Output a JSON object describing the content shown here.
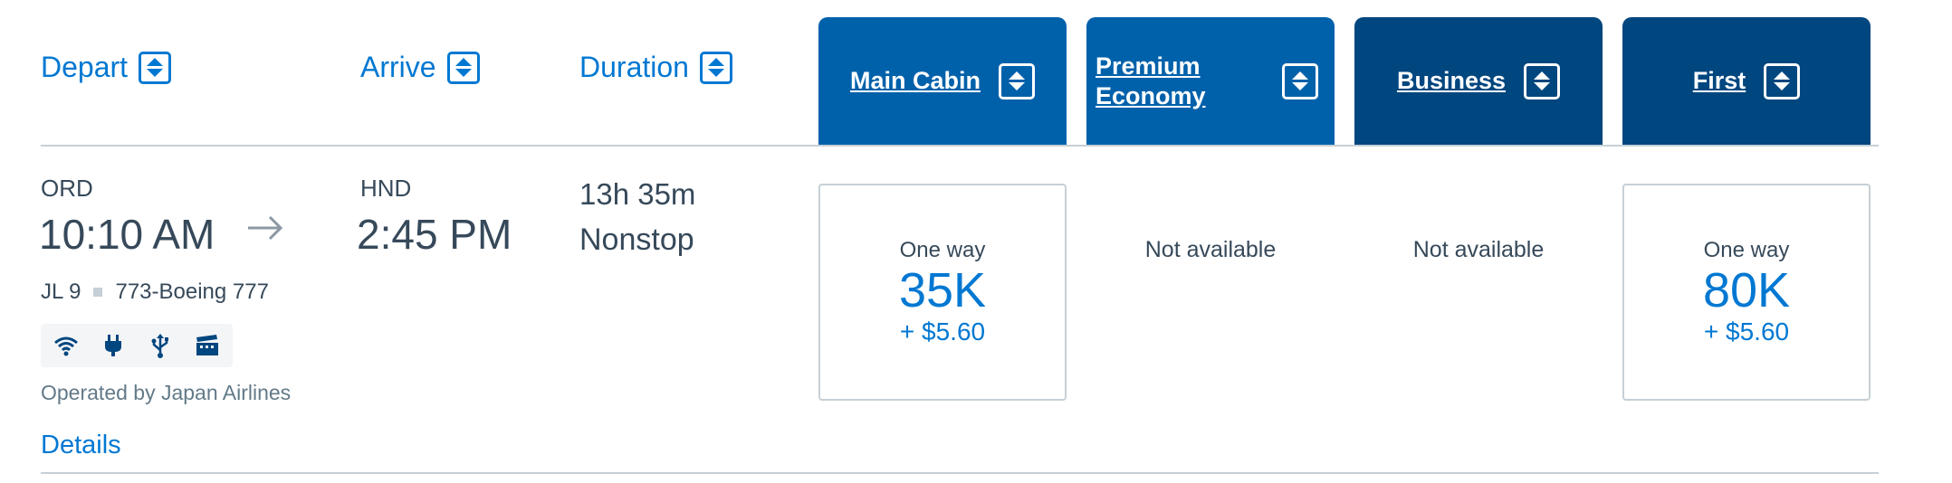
{
  "columns": {
    "depart": "Depart",
    "arrive": "Arrive",
    "duration": "Duration"
  },
  "cabins": [
    {
      "label": "Main Cabin",
      "color": "#0061ab"
    },
    {
      "label": "Premium Economy",
      "color": "#0061ab"
    },
    {
      "label": "Business",
      "color": "#00467f"
    },
    {
      "label": "First",
      "color": "#00467f"
    }
  ],
  "flight": {
    "origin_code": "ORD",
    "depart_time": "10:10 AM",
    "dest_code": "HND",
    "arrive_time": "2:45 PM",
    "duration": "13h 35m",
    "stops": "Nonstop",
    "flight_number": "JL 9",
    "aircraft": "773-Boeing 777",
    "amenities": [
      "wifi-icon",
      "power-outlet-icon",
      "usb-icon",
      "entertainment-icon"
    ],
    "operated_by": "Operated by Japan Airlines",
    "details_link": "Details"
  },
  "fares": {
    "main_cabin": {
      "label": "One way",
      "miles": "35K",
      "tax": "+ $5.60"
    },
    "premium_economy": {
      "status": "Not available"
    },
    "business": {
      "status": "Not available"
    },
    "first": {
      "label": "One way",
      "miles": "80K",
      "tax": "+ $5.60"
    }
  },
  "colors": {
    "accent": "#0078d2",
    "text": "#36495a",
    "divider": "#c6d0d6"
  }
}
